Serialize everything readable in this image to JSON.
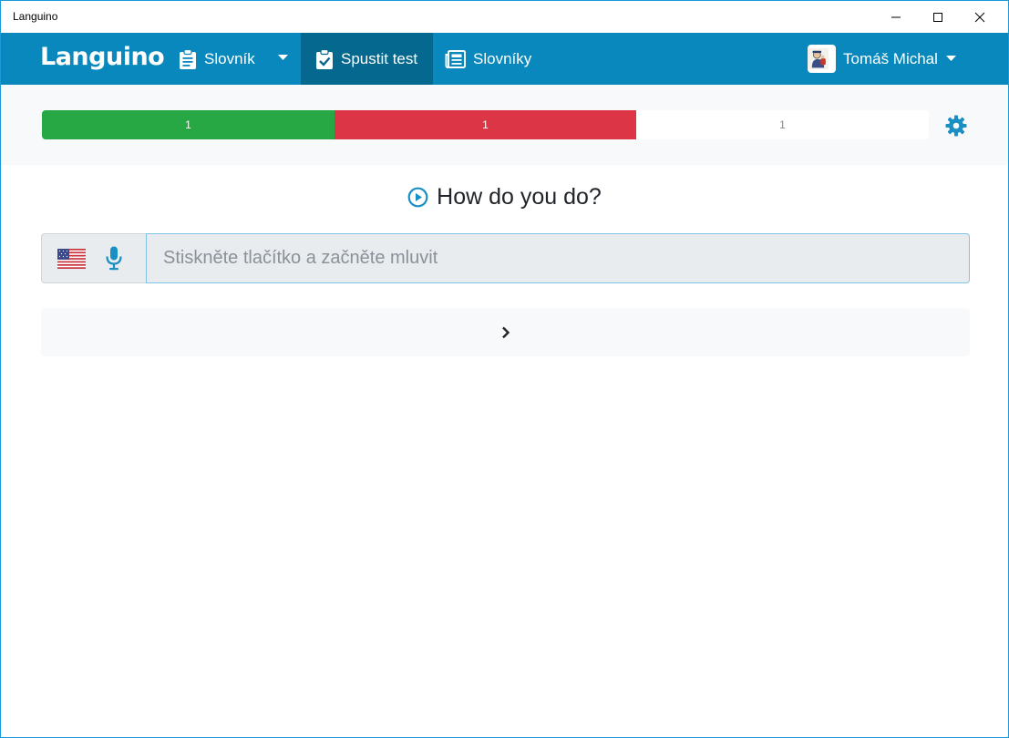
{
  "window": {
    "title": "Languino",
    "controls": [
      "minimize-icon",
      "maximize-icon",
      "close-icon"
    ]
  },
  "navbar": {
    "brand": "Languino",
    "items": [
      {
        "label": "Slovník",
        "icon": "clipboard-icon",
        "has_dropdown": true,
        "active": false
      },
      {
        "label": "Spustit test",
        "icon": "clipboard-check-icon",
        "active": true
      },
      {
        "label": "Slovníky",
        "icon": "newspaper-icon",
        "active": false
      }
    ],
    "user": {
      "name": "Tomáš Michal",
      "has_dropdown": true
    }
  },
  "progress": {
    "correct": "1",
    "wrong": "1",
    "remaining": "1",
    "colors": {
      "correct": "#28a745",
      "wrong": "#dc3545",
      "remaining": "#ffffff"
    }
  },
  "question": {
    "text": "How do you do?",
    "icon": "play-circle-icon"
  },
  "answer": {
    "language_flag": "us-flag-icon",
    "mic_icon": "microphone-icon",
    "placeholder": "Stiskněte tlačítko a začněte mluvit",
    "value": ""
  },
  "next_button": {
    "icon": "chevron-right-icon"
  },
  "colors": {
    "navbar": "#0888bd",
    "navbar_active": "#05688f",
    "accent": "#1a8fc4"
  }
}
